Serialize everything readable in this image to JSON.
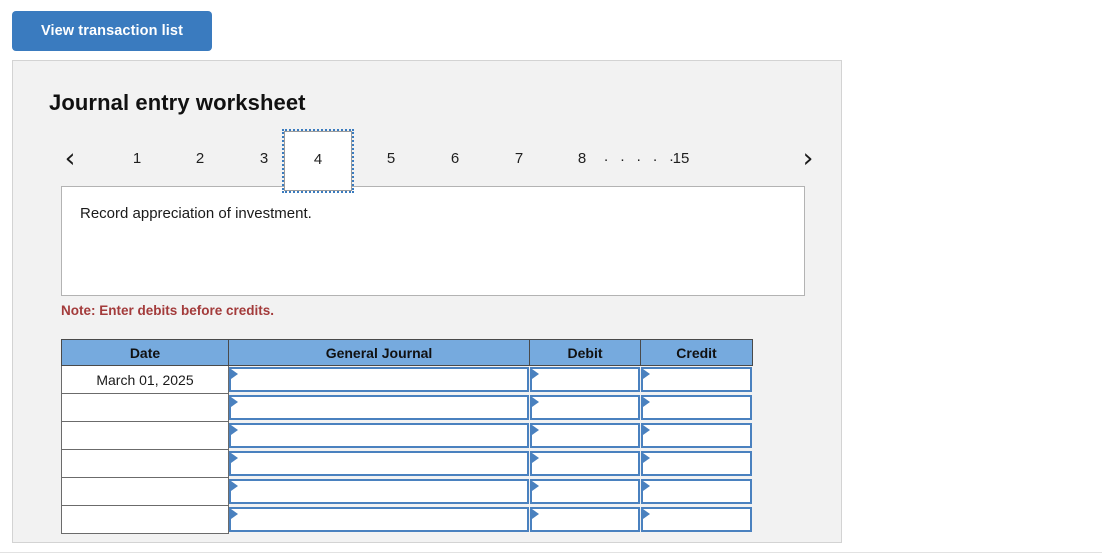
{
  "toolbar": {
    "view_transaction_list_label": "View transaction list"
  },
  "panel": {
    "title": "Journal entry worksheet",
    "pager": {
      "prev_icon": "chevron-left-icon",
      "next_icon": "chevron-right-icon",
      "prev_glyph": "‹",
      "next_glyph": "›",
      "ellipsis": ". . . . .",
      "selected": "4",
      "pages": [
        "1",
        "2",
        "3",
        "4",
        "5",
        "6",
        "7",
        "8",
        "15"
      ]
    },
    "description": "Record appreciation of investment.",
    "note": "Note: Enter debits before credits.",
    "table": {
      "headers": [
        "Date",
        "General Journal",
        "Debit",
        "Credit"
      ],
      "rows": [
        {
          "date": "March 01, 2025",
          "general_journal": "",
          "debit": "",
          "credit": ""
        },
        {
          "date": "",
          "general_journal": "",
          "debit": "",
          "credit": ""
        },
        {
          "date": "",
          "general_journal": "",
          "debit": "",
          "credit": ""
        },
        {
          "date": "",
          "general_journal": "",
          "debit": "",
          "credit": ""
        },
        {
          "date": "",
          "general_journal": "",
          "debit": "",
          "credit": ""
        },
        {
          "date": "",
          "general_journal": "",
          "debit": "",
          "credit": ""
        }
      ]
    }
  },
  "colors": {
    "button_blue": "#3a7bbf",
    "header_blue": "#76aade",
    "input_border_blue": "#4a81bf",
    "note_red": "#a33b3b",
    "panel_bg": "#f2f2f2"
  }
}
